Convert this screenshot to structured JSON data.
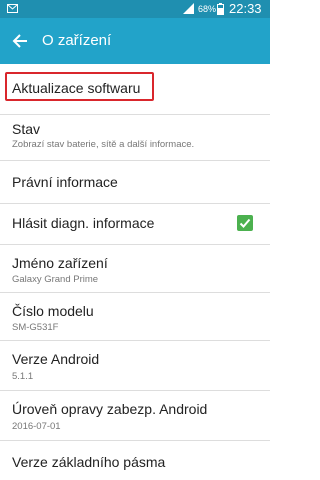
{
  "status_bar": {
    "battery_percent": "68%",
    "time": "22:33",
    "icons": [
      "mail-icon",
      "signal-icon",
      "battery-icon"
    ]
  },
  "app_bar": {
    "title": "O zařízení",
    "back_icon": "arrow-back-icon"
  },
  "items": [
    {
      "title": "Aktualizace softwaru"
    },
    {
      "title": "Stav",
      "subtitle": "Zobrazí stav baterie, sítě a další informace."
    },
    {
      "title": "Právní informace"
    },
    {
      "title": "Hlásit diagn. informace",
      "checked": true
    },
    {
      "title": "Jméno zařízení",
      "subtitle": "Galaxy Grand Prime"
    },
    {
      "title": "Číslo modelu",
      "subtitle": "SM-G531F"
    },
    {
      "title": "Verze Android",
      "subtitle": "5.1.1"
    },
    {
      "title": "Úroveň opravy zabezp. Android",
      "subtitle": "2016-07-01"
    },
    {
      "title": "Verze základního pásma"
    }
  ],
  "colors": {
    "status_bar": "#1f8fb0",
    "app_bar": "#22a3c9",
    "highlight": "#d9262c",
    "checkbox": "#4cb14f"
  }
}
